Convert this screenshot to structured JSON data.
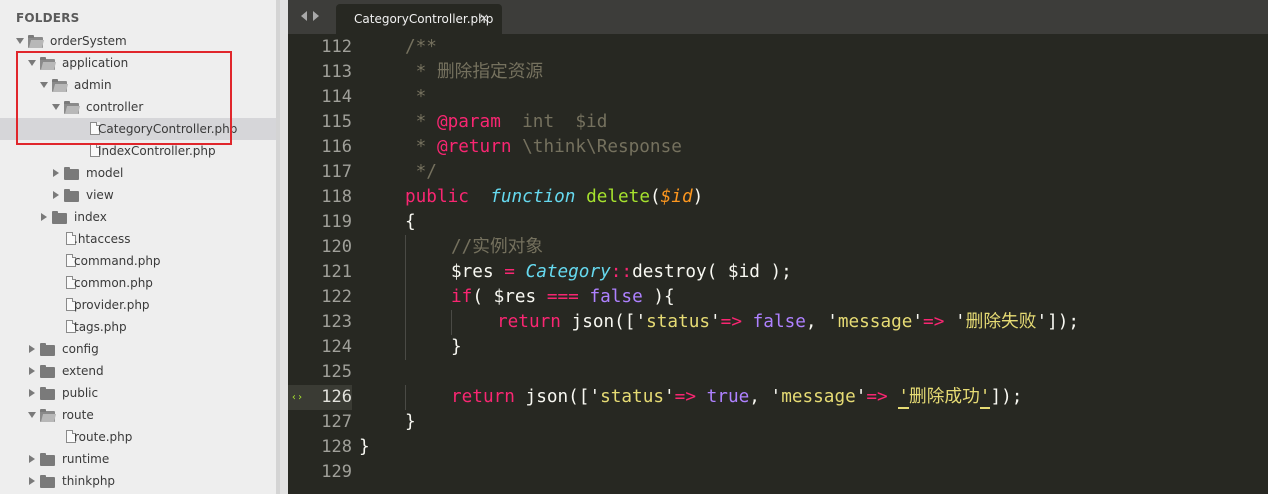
{
  "sidebar": {
    "title": "FOLDERS",
    "items": [
      {
        "label": "orderSystem",
        "type": "folder-open",
        "depth": 0
      },
      {
        "label": "application",
        "type": "folder-open",
        "depth": 1
      },
      {
        "label": "admin",
        "type": "folder-open",
        "depth": 2
      },
      {
        "label": "controller",
        "type": "folder-open",
        "depth": 3
      },
      {
        "label": "CategoryController.php",
        "type": "file",
        "depth": 4,
        "selected": true
      },
      {
        "label": "IndexController.php",
        "type": "file",
        "depth": 4
      },
      {
        "label": "model",
        "type": "folder-closed",
        "depth": 3
      },
      {
        "label": "view",
        "type": "folder-closed",
        "depth": 3
      },
      {
        "label": "index",
        "type": "folder-closed",
        "depth": 2
      },
      {
        "label": ".htaccess",
        "type": "file",
        "depth": 2
      },
      {
        "label": "command.php",
        "type": "file",
        "depth": 2
      },
      {
        "label": "common.php",
        "type": "file",
        "depth": 2
      },
      {
        "label": "provider.php",
        "type": "file",
        "depth": 2
      },
      {
        "label": "tags.php",
        "type": "file",
        "depth": 2
      },
      {
        "label": "config",
        "type": "folder-closed",
        "depth": 1
      },
      {
        "label": "extend",
        "type": "folder-closed",
        "depth": 1
      },
      {
        "label": "public",
        "type": "folder-closed",
        "depth": 1
      },
      {
        "label": "route",
        "type": "folder-open",
        "depth": 1
      },
      {
        "label": "route.php",
        "type": "file",
        "depth": 2
      },
      {
        "label": "runtime",
        "type": "folder-closed",
        "depth": 1
      },
      {
        "label": "thinkphp",
        "type": "folder-closed",
        "depth": 1
      }
    ]
  },
  "tabs": [
    {
      "label": "CategoryController.php",
      "close": "×",
      "active": true
    }
  ],
  "editor": {
    "active_line": "126",
    "line_numbers": [
      "112",
      "113",
      "114",
      "115",
      "116",
      "117",
      "118",
      "119",
      "120",
      "121",
      "122",
      "123",
      "124",
      "125",
      "126",
      "127",
      "128",
      "129"
    ],
    "lines": [
      {
        "indent": 1,
        "tokens": [
          [
            "cm",
            "/**"
          ]
        ]
      },
      {
        "indent": 1,
        "tokens": [
          [
            "cm",
            " * 删除指定资源"
          ]
        ]
      },
      {
        "indent": 1,
        "tokens": [
          [
            "cm",
            " *"
          ]
        ]
      },
      {
        "indent": 1,
        "tokens": [
          [
            "cm",
            " * "
          ],
          [
            "tg",
            "@param"
          ],
          [
            "cm",
            "  int  $id"
          ]
        ]
      },
      {
        "indent": 1,
        "tokens": [
          [
            "cm",
            " * "
          ],
          [
            "tg",
            "@return"
          ],
          [
            "cm",
            " \\think\\Response"
          ]
        ]
      },
      {
        "indent": 1,
        "tokens": [
          [
            "cm",
            " */"
          ]
        ]
      },
      {
        "indent": 1,
        "tokens": [
          [
            "kw",
            "public"
          ],
          [
            "",
            "  "
          ],
          [
            "st",
            "function"
          ],
          [
            "",
            " "
          ],
          [
            "fn",
            "delete"
          ],
          [
            "",
            "("
          ],
          [
            "pm",
            "$id"
          ],
          [
            "",
            ")"
          ]
        ]
      },
      {
        "indent": 1,
        "tokens": [
          [
            "",
            "{"
          ]
        ]
      },
      {
        "indent": 2,
        "tokens": [
          [
            "cm",
            "//实例对象"
          ]
        ]
      },
      {
        "indent": 2,
        "tokens": [
          [
            "",
            "$res "
          ],
          [
            "kw",
            "="
          ],
          [
            "",
            " "
          ],
          [
            "st",
            "Category"
          ],
          [
            "kw",
            "::"
          ],
          [
            "",
            "destroy( $id );"
          ]
        ]
      },
      {
        "indent": 2,
        "tokens": [
          [
            "kw",
            "if"
          ],
          [
            "",
            "( $res "
          ],
          [
            "kw",
            "==="
          ],
          [
            "",
            " "
          ],
          [
            "cn",
            "false"
          ],
          [
            "",
            " ){"
          ]
        ]
      },
      {
        "indent": 3,
        "tokens": [
          [
            "kw",
            "return"
          ],
          [
            "",
            " json(['"
          ],
          [
            "str",
            "status"
          ],
          [
            "",
            "'"
          ],
          [
            "kw",
            "=>"
          ],
          [
            "",
            " "
          ],
          [
            "cn",
            "false"
          ],
          [
            "",
            ", '"
          ],
          [
            "str",
            "message"
          ],
          [
            "",
            "'"
          ],
          [
            "kw",
            "=>"
          ],
          [
            "",
            " '"
          ],
          [
            "str",
            "删除失败"
          ],
          [
            "",
            "']);"
          ]
        ]
      },
      {
        "indent": 2,
        "tokens": [
          [
            "",
            "}"
          ]
        ]
      },
      {
        "indent": 0,
        "tokens": []
      },
      {
        "indent": 2,
        "tokens": [
          [
            "kw",
            "return"
          ],
          [
            "",
            " json(['"
          ],
          [
            "str",
            "status"
          ],
          [
            "",
            "'"
          ],
          [
            "kw",
            "=>"
          ],
          [
            "",
            " "
          ],
          [
            "cn",
            "true"
          ],
          [
            "",
            ", '"
          ],
          [
            "str",
            "message"
          ],
          [
            "",
            "'"
          ],
          [
            "kw",
            "=>"
          ],
          [
            "",
            " "
          ],
          [
            "str-u",
            "'删除成功'"
          ],
          [
            "",
            "]);"
          ]
        ]
      },
      {
        "indent": 1,
        "tokens": [
          [
            "",
            "}"
          ]
        ]
      },
      {
        "indent": 0,
        "tokens": [
          [
            "",
            "}"
          ]
        ]
      },
      {
        "indent": 0,
        "tokens": []
      }
    ]
  },
  "colors": {
    "background": "#272822",
    "comment": "#75715e",
    "keyword": "#f92672",
    "function": "#a6e22e",
    "string": "#e6db74",
    "constant": "#ae81ff",
    "storage": "#66d9ef",
    "highlight_box": "#e0262b"
  }
}
